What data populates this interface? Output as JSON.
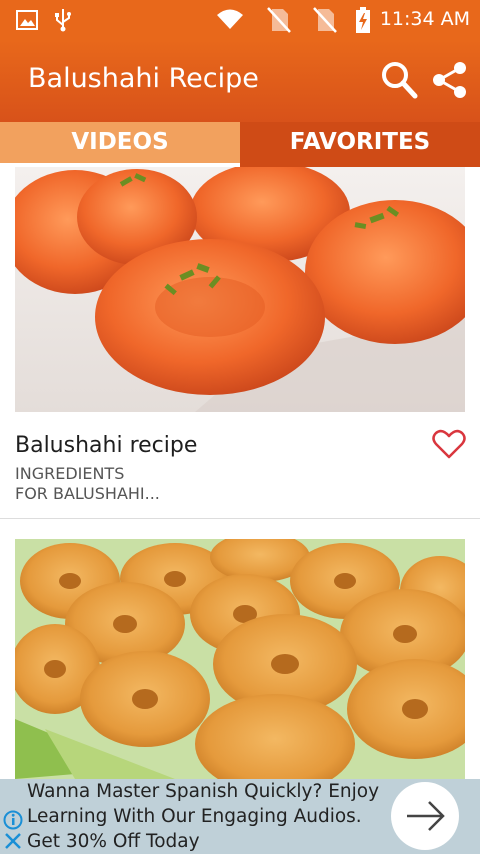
{
  "status_bar": {
    "time": "11:34 AM",
    "icons": [
      "image-icon",
      "usb-icon",
      "wifi-icon",
      "no-sim-icon",
      "no-sim-icon",
      "battery-charging-icon"
    ]
  },
  "app_bar": {
    "title": "Balushahi Recipe",
    "actions": [
      "search-icon",
      "share-icon"
    ]
  },
  "tabs": [
    {
      "label": "VIDEOS",
      "selected": true
    },
    {
      "label": "FAVORITES",
      "selected": false
    }
  ],
  "recipes": [
    {
      "title": "Balushahi recipe",
      "description": "INGREDIENTS\nFOR BALUSHAHI...",
      "favorite": false,
      "image": "glazed balushahi with pistachio garnish"
    },
    {
      "title": "",
      "description": "",
      "favorite": false,
      "image": "balushahi on a leaf plate"
    }
  ],
  "ad": {
    "text": "Wanna Master Spanish Quickly? Enjoy Learning With Our Engaging Audios. Get 30% Off Today",
    "icons": [
      "info-icon",
      "close-icon",
      "arrow-right-icon"
    ]
  },
  "colors": {
    "accent": "#e8681b",
    "tab_selected": "#f2a15e",
    "tab_unselected": "#cf4b16",
    "heart": "#d9363e",
    "ad_background": "#bfd0d8"
  }
}
